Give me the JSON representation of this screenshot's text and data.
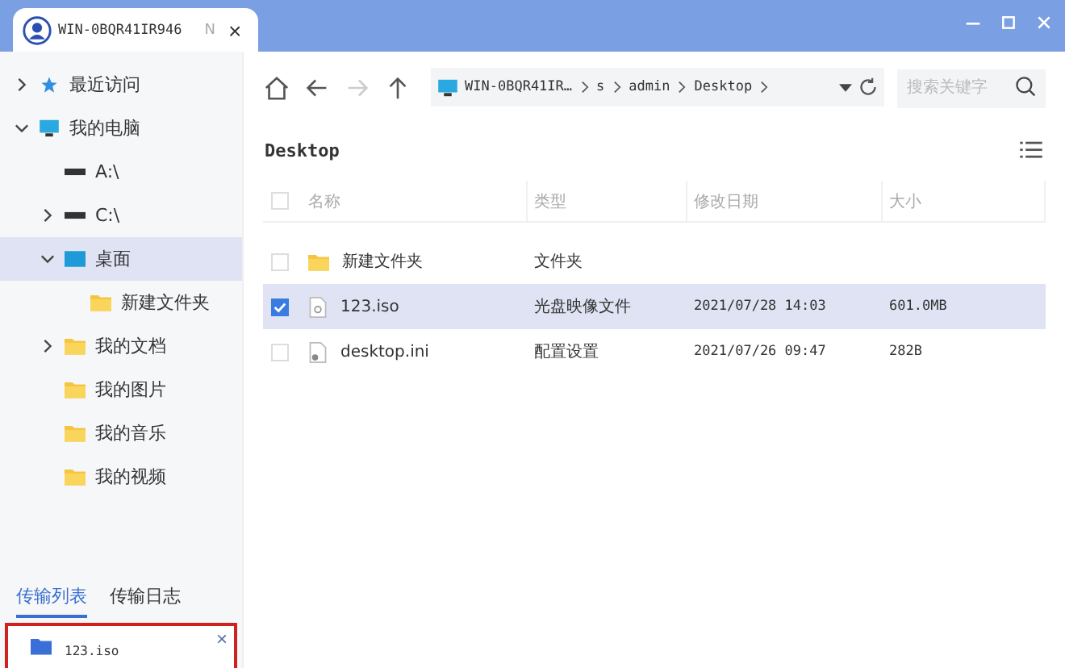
{
  "window": {
    "tab": {
      "title": "WIN-0BQR41IR946",
      "suffix": "N",
      "close": "×"
    }
  },
  "sidebar": {
    "tree": [
      {
        "label": "最近访问",
        "kind": "star",
        "expanded": false,
        "selected": false
      },
      {
        "label": "我的电脑",
        "kind": "monitor",
        "expanded": true,
        "selected": false,
        "children": [
          {
            "label": "A:\\",
            "kind": "drive",
            "selected": false
          },
          {
            "label": "C:\\",
            "kind": "drive",
            "expanded": false,
            "selected": false
          },
          {
            "label": "桌面",
            "kind": "desktop",
            "expanded": true,
            "selected": true,
            "children": [
              {
                "label": "新建文件夹",
                "kind": "folder",
                "selected": false
              }
            ]
          },
          {
            "label": "我的文档",
            "kind": "folder",
            "expanded": false,
            "selected": false
          },
          {
            "label": "我的图片",
            "kind": "folder",
            "selected": false
          },
          {
            "label": "我的音乐",
            "kind": "folder",
            "selected": false
          },
          {
            "label": "我的视频",
            "kind": "folder",
            "selected": false
          }
        ]
      }
    ]
  },
  "transfer": {
    "tabs": [
      {
        "label": "传输列表",
        "selected": true
      },
      {
        "label": "传输日志",
        "selected": false
      }
    ],
    "items": [
      {
        "name": "123.iso",
        "close": "×"
      }
    ]
  },
  "toolbar": {
    "path": [
      "WIN-0BQR41IR…",
      "s",
      "admin",
      "Desktop"
    ],
    "search": {
      "placeholder": "搜索关键字"
    }
  },
  "content": {
    "title": "Desktop",
    "table": {
      "columns": [
        "名称",
        "类型",
        "修改日期",
        "大小"
      ],
      "all_checked": false,
      "rows": [
        {
          "kind": "folder",
          "name": "新建文件夹",
          "type": "文件夹",
          "checked": false,
          "selected": false
        },
        {
          "kind": "disc",
          "name": "123.iso",
          "type": "光盘映像文件",
          "date": "2021/07/28 14:03",
          "size": "601.0MB",
          "checked": true,
          "selected": true
        },
        {
          "kind": "config",
          "name": "desktop.ini",
          "type": "配置设置",
          "date": "2021/07/26 09:47",
          "size": "282B",
          "checked": false,
          "selected": false
        }
      ]
    }
  }
}
